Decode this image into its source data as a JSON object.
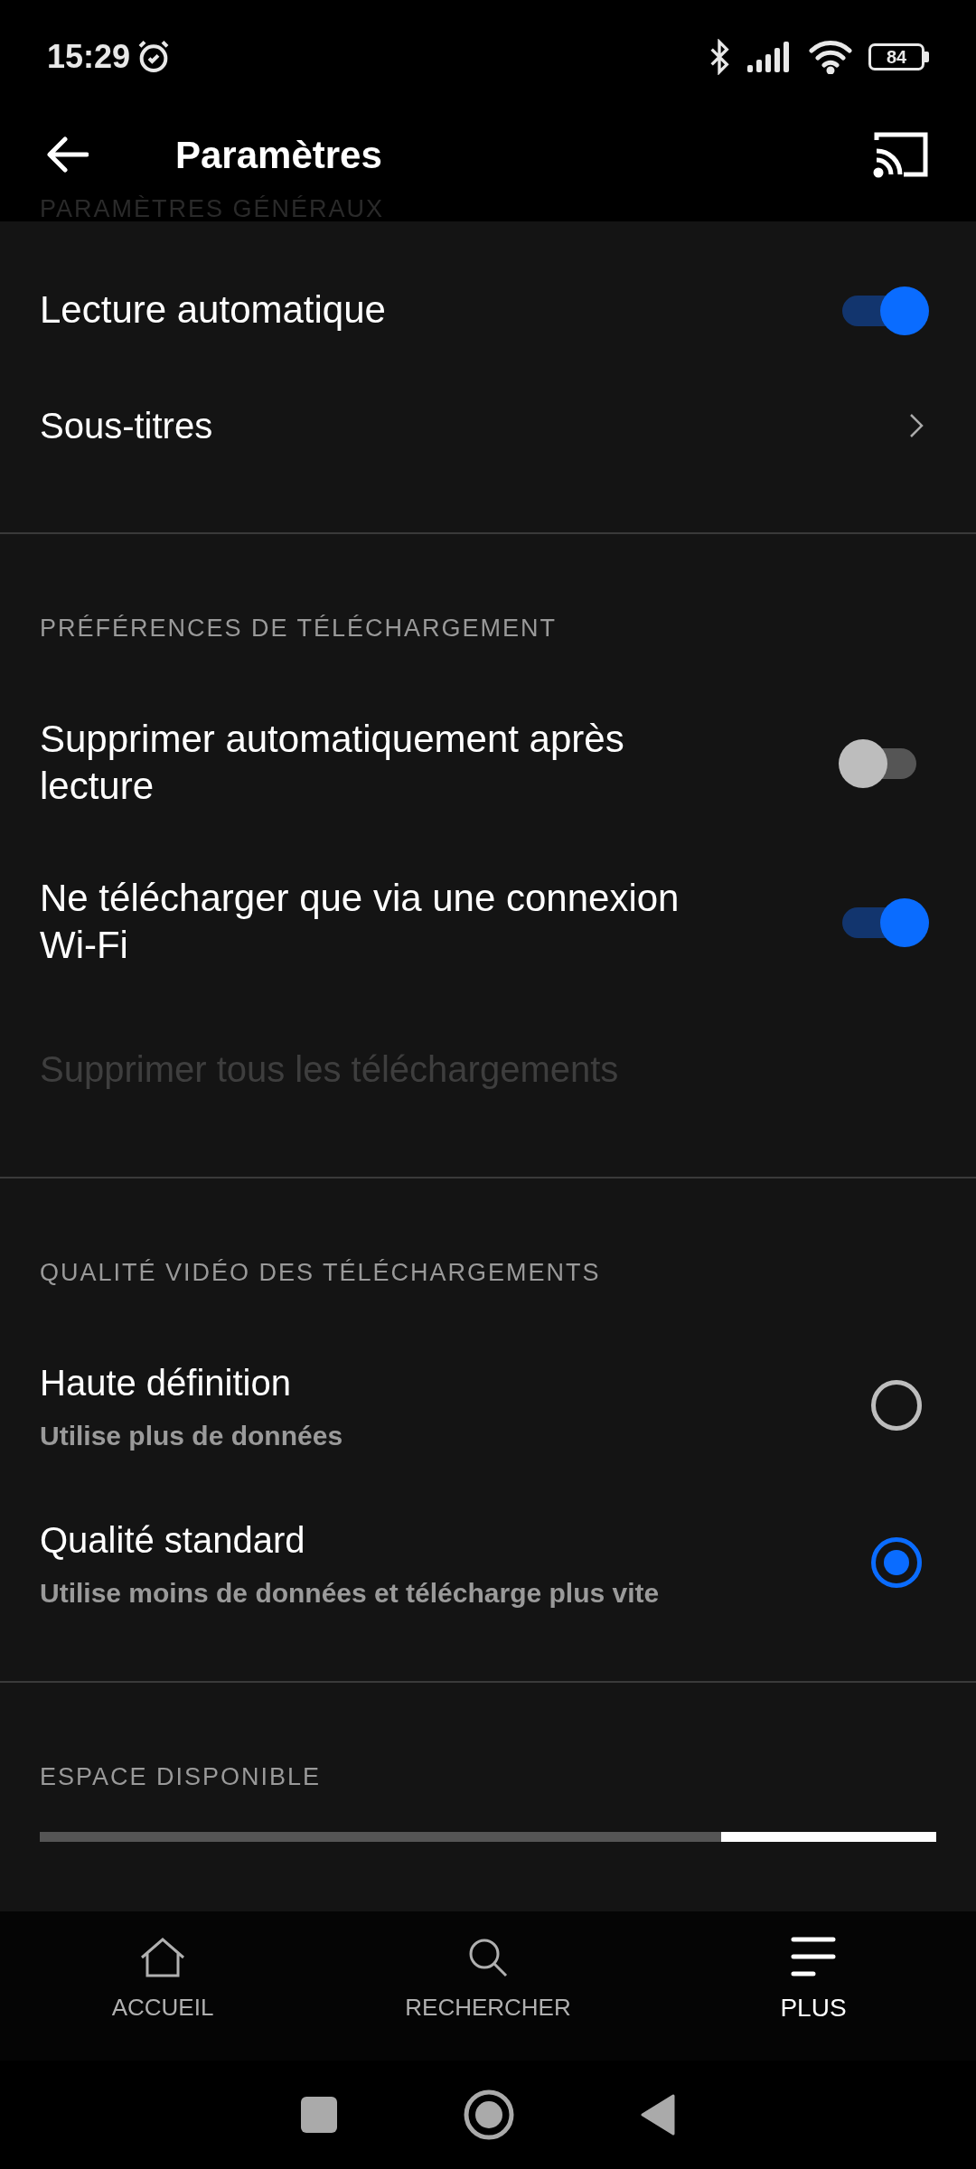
{
  "status_bar": {
    "time": "15:29",
    "battery": "84"
  },
  "app_bar": {
    "title": "Paramètres"
  },
  "sections": [
    {
      "header": "PARAMÈTRES GÉNÉRAUX",
      "items": [
        {
          "kind": "toggle",
          "label": "Lecture automatique",
          "on": true
        },
        {
          "kind": "link",
          "label": "Sous-titres"
        }
      ]
    },
    {
      "header": "PRÉFÉRENCES DE TÉLÉCHARGEMENT",
      "items": [
        {
          "kind": "toggle",
          "label": "Supprimer automatiquement après lecture",
          "on": false
        },
        {
          "kind": "toggle",
          "label": "Ne télécharger que via une connexion Wi-Fi",
          "on": true
        },
        {
          "kind": "action",
          "label": "Supprimer tous les téléchargements",
          "disabled": true
        }
      ]
    },
    {
      "header": "QUALITÉ VIDÉO DES TÉLÉCHARGEMENTS",
      "items": [
        {
          "kind": "radio",
          "label": "Haute définition",
          "sublabel": "Utilise plus de données",
          "selected": false
        },
        {
          "kind": "radio",
          "label": "Qualité standard",
          "sublabel": "Utilise moins de données et télécharge plus vite",
          "selected": true
        }
      ]
    },
    {
      "header": "ESPACE DISPONIBLE",
      "items": [
        {
          "kind": "storage",
          "level": 0.76
        }
      ]
    }
  ],
  "bottom_nav": [
    {
      "label": "ACCUEIL",
      "selected": false
    },
    {
      "label": "RECHERCHER",
      "selected": false
    },
    {
      "label": "PLUS",
      "selected": true
    }
  ]
}
